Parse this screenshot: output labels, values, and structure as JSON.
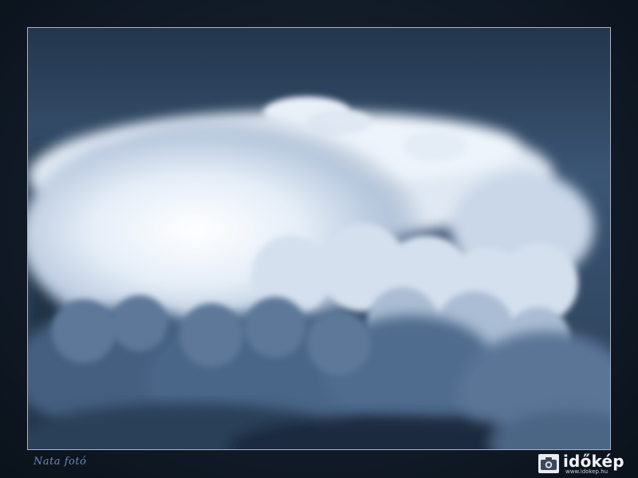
{
  "photo": {
    "subject": "anvil-cloud",
    "colors": {
      "sky_top": "#2a3d55",
      "sky_mid": "#3e5878",
      "cloud_white": "#eef4fb",
      "cloud_blue": "#8fa8c6",
      "shadow": "#1a2838"
    }
  },
  "credit": {
    "signature": "Nata fotó"
  },
  "brand": {
    "name": "időkép",
    "url": "www.idokep.hu",
    "icon": "camera-icon"
  }
}
